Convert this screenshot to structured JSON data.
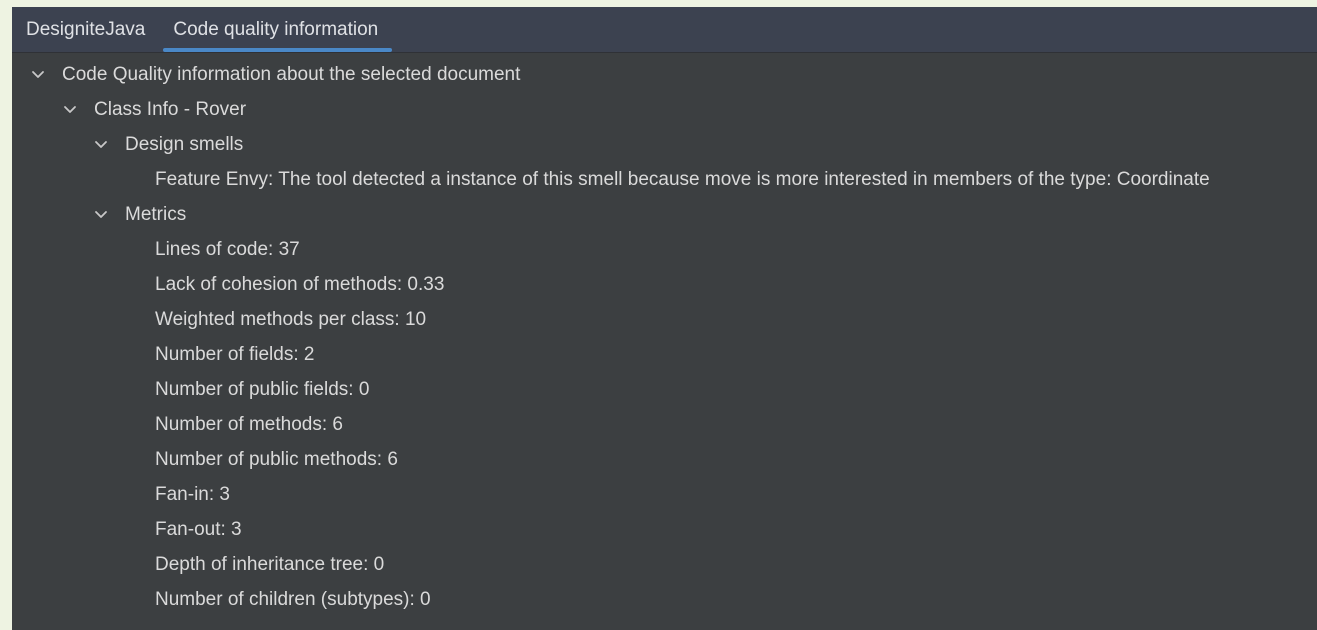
{
  "tabs": [
    {
      "label": "DesigniteJava",
      "active": false
    },
    {
      "label": "Code quality information",
      "active": true
    }
  ],
  "tree": {
    "root_label": "Code Quality information about the selected document",
    "class_info_label": "Class Info - Rover",
    "design_smells": {
      "label": "Design smells",
      "items": [
        "Feature Envy: The tool detected a instance of this smell because move is more interested in members of the type: Coordinate"
      ]
    },
    "metrics": {
      "label": "Metrics",
      "items": [
        "Lines of code: 37",
        "Lack of cohesion of methods: 0.33",
        "Weighted methods per class: 10",
        "Number of fields: 2",
        "Number of public fields: 0",
        "Number of methods: 6",
        "Number of public methods: 6",
        "Fan-in: 3",
        "Fan-out: 3",
        "Depth of inheritance tree: 0",
        "Number of children (subtypes): 0"
      ]
    }
  },
  "icons": {
    "expanded": "chevron-down-icon"
  },
  "colors": {
    "panel_background": "#3c3f41",
    "tabbar_background": "#3c4250",
    "active_tab_underline": "#4a88c7",
    "text": "#dadada",
    "outer_background": "#eef3e2"
  }
}
